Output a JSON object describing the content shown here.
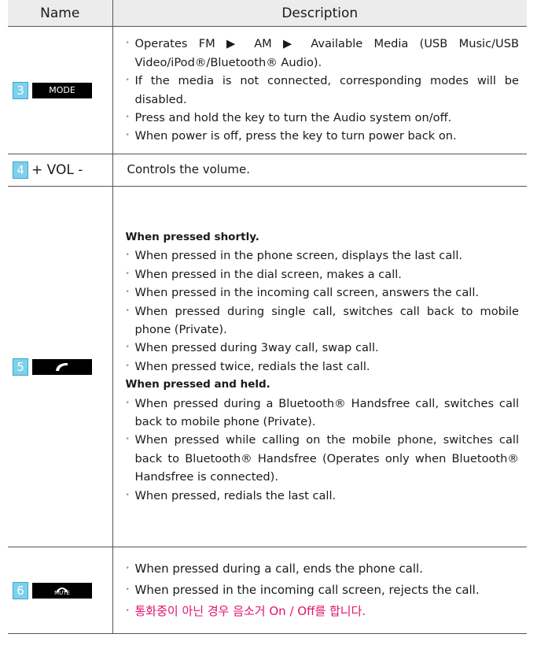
{
  "header": {
    "name": "Name",
    "description": "Description"
  },
  "rows": [
    {
      "num": "3",
      "key": "MODE",
      "items": [
        "Operates FM ▶ AM ▶ Available Media (USB Music/USB Video/iPod®/Bluetooth® Audio).",
        "If the media is not connected, corresponding modes will be disabled.",
        "Press and hold the key to turn the Audio system on/off.",
        "When power is off, press the key to turn power back on."
      ]
    },
    {
      "num": "4",
      "key": "+ VOL -",
      "text": "Controls the volume."
    },
    {
      "num": "5",
      "key_icon": "phone-call-icon",
      "heading1": "When pressed shortly.",
      "items1": [
        "When pressed in the phone screen, displays the last call.",
        "When pressed in the dial screen, makes a call.",
        "When pressed in the incoming call screen, answers the call.",
        "When pressed during single call, switches call back to mobile phone (Private).",
        "When pressed during 3way call, swap call.",
        "When pressed twice, redials the last call."
      ],
      "heading2": "When pressed and held.",
      "items2": [
        "When pressed during a Bluetooth® Handsfree call, switches call back to mobile phone (Private).",
        "When pressed while calling on the mobile phone, switches call back to Bluetooth® Handsfree (Operates only when Bluetooth® Handsfree is connected).",
        "When pressed, redials the last call."
      ]
    },
    {
      "num": "6",
      "key_icon": "end-call-icon",
      "key_label": "MUTE",
      "items": [
        "When pressed during a call, ends the phone call.",
        "When pressed in the incoming call screen, rejects the call.",
        "통화중이 아닌 경우 음소거 On / Off를 합니다."
      ]
    }
  ],
  "colors": {
    "number_badge": "#7fd0ea",
    "korean_text": "#e0136b",
    "header_bg": "#ececec"
  }
}
